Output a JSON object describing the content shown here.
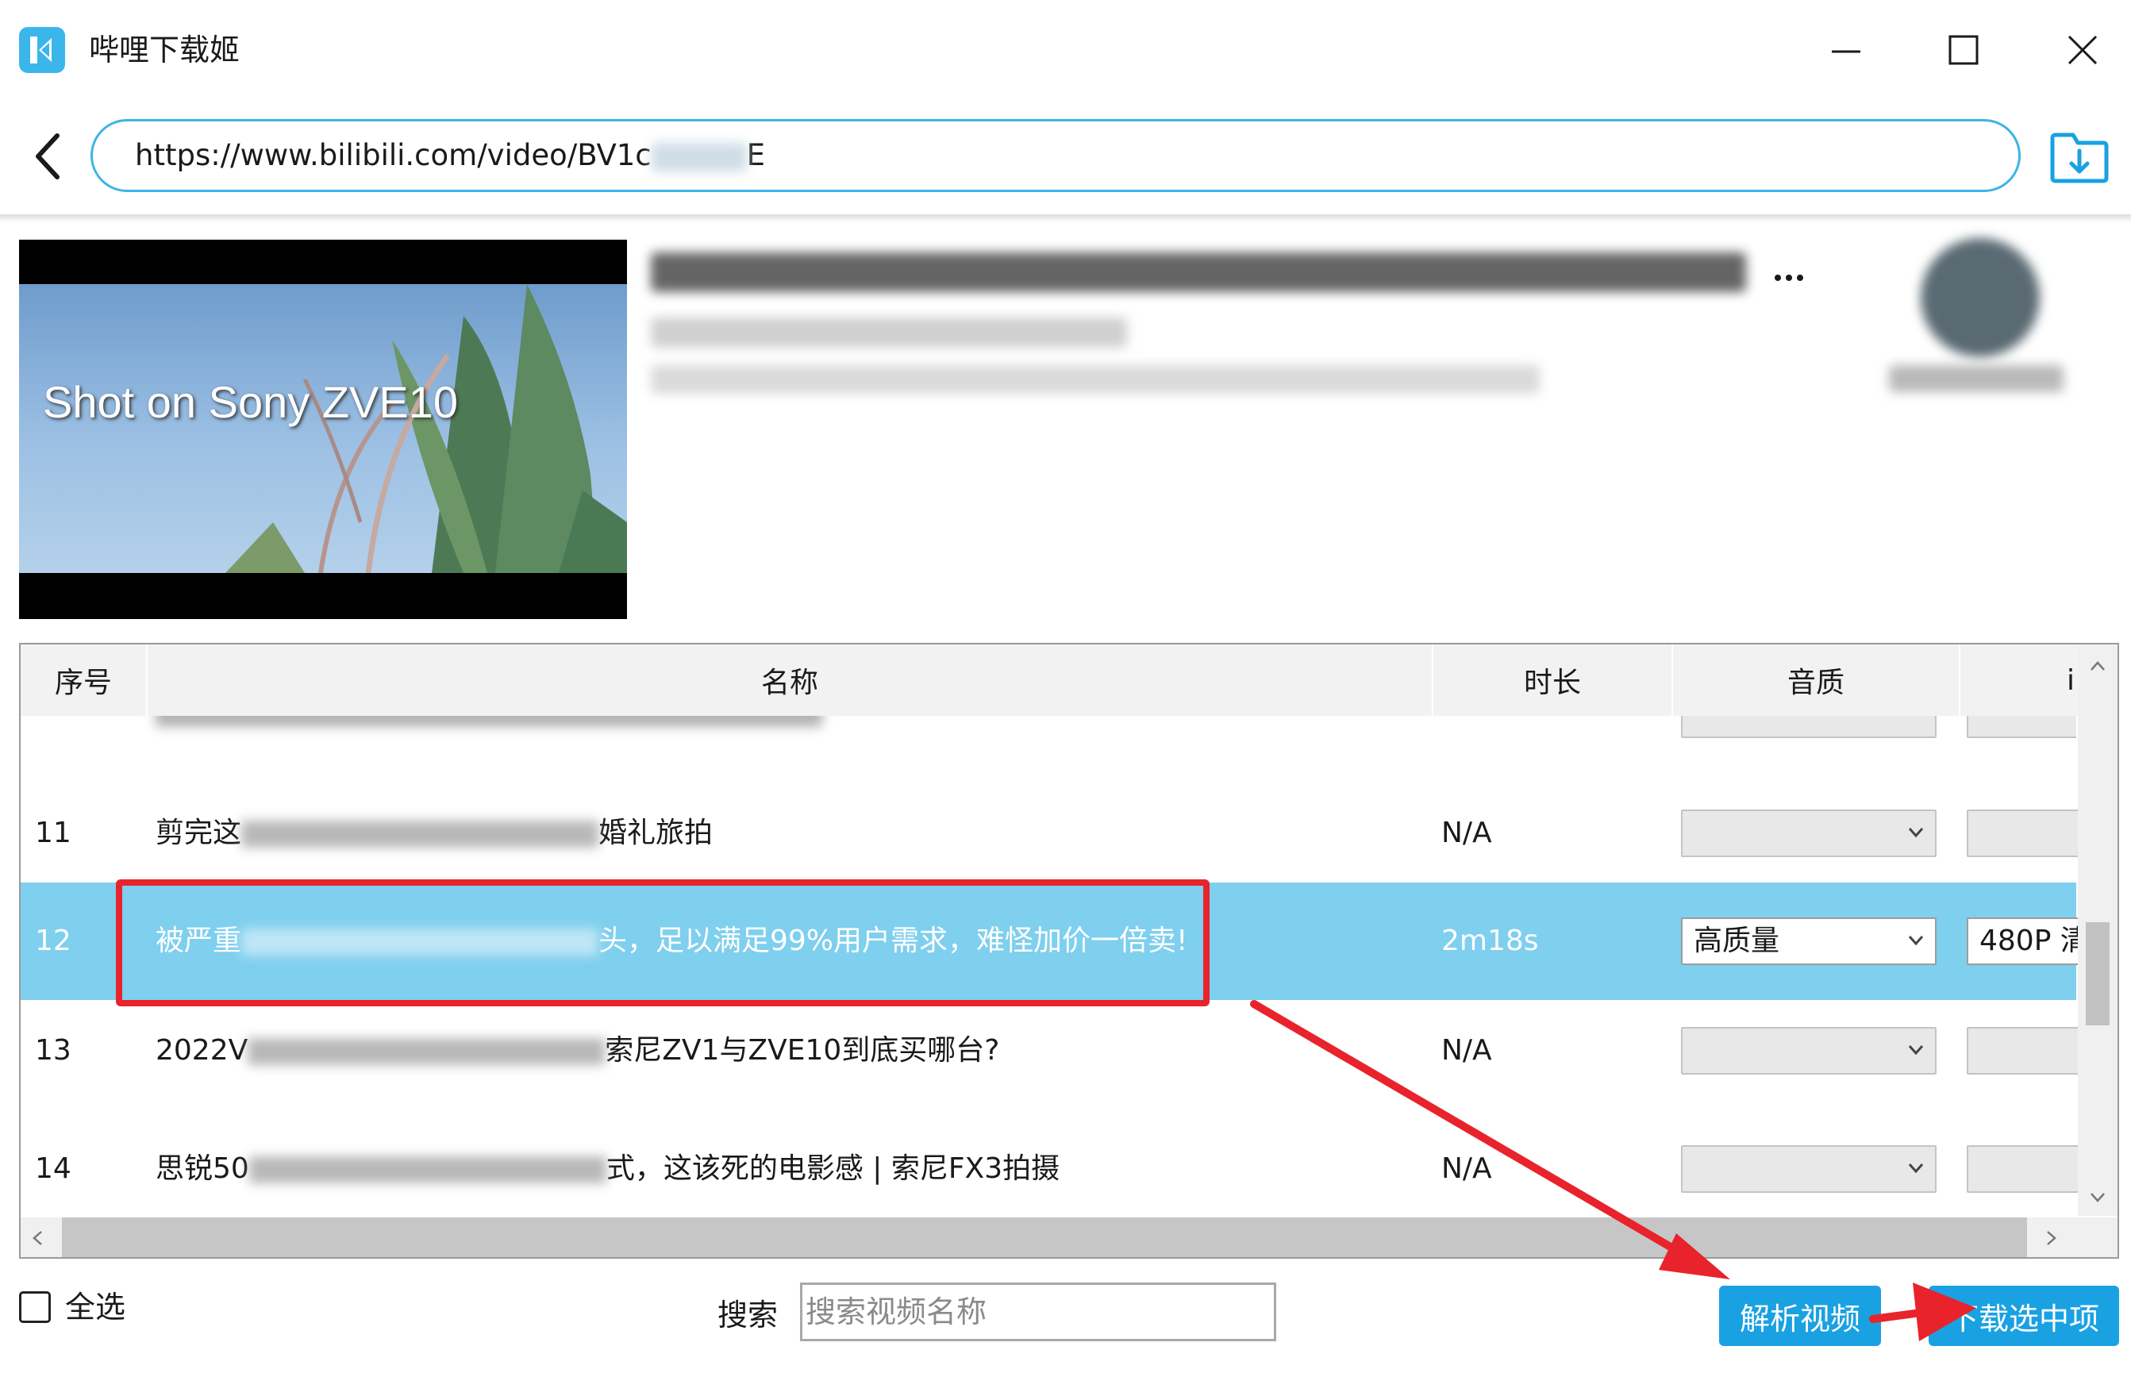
{
  "window": {
    "title": "哔哩下载姬",
    "controls": [
      "minimize-icon",
      "maximize-icon",
      "close-icon"
    ]
  },
  "address_bar": {
    "url_prefix": "https://www.bilibili.com/video/BV1c",
    "url_suffix": "E"
  },
  "video": {
    "thumbnail_caption": "Shot on Sony ZVE10"
  },
  "table": {
    "columns": [
      "序号",
      "名称",
      "时长",
      "音质",
      "i"
    ],
    "rows": [
      {
        "index": "11",
        "name_start": "剪完这",
        "name_end": "婚礼旅拍",
        "duration": "N/A",
        "audio": "",
        "video": "",
        "selected": false
      },
      {
        "index": "12",
        "name_start": "被严重",
        "name_end": "头，足以满足99%用户需求，难怪加价一倍卖!",
        "duration": "2m18s",
        "audio": "高质量",
        "video": "480P 清",
        "selected": true
      },
      {
        "index": "13",
        "name_start": "2022V",
        "name_end": "索尼ZV1与ZVE10到底买哪台?",
        "duration": "N/A",
        "audio": "",
        "video": "",
        "selected": false
      },
      {
        "index": "14",
        "name_start": "思锐50",
        "name_end": "式，这该死的电影感 | 索尼FX3拍摄",
        "duration": "N/A",
        "audio": "",
        "video": "",
        "selected": false
      }
    ]
  },
  "bottom": {
    "select_all_label": "全选",
    "search_label": "搜索",
    "search_placeholder": "搜索视频名称",
    "parse_button": "解析视频",
    "download_button": "下载选中项"
  },
  "colors": {
    "accent": "#1aa1e2",
    "selected_row": "#7fcfee",
    "annotation_red": "#e8232b",
    "url_border": "#3cb4e6"
  }
}
